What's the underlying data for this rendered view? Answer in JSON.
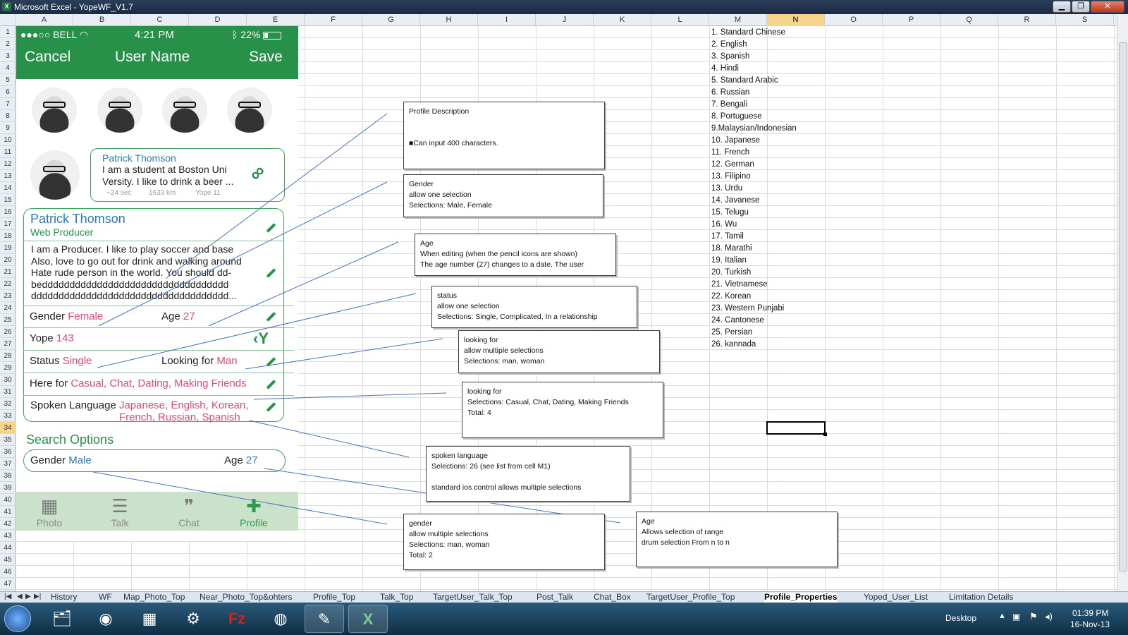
{
  "window": {
    "title": "Microsoft Excel - YopeWF_V1.7",
    "min": "▁",
    "max": "❐",
    "close": "✕"
  },
  "columns": [
    "A",
    "B",
    "C",
    "D",
    "E",
    "F",
    "G",
    "H",
    "I",
    "J",
    "K",
    "L",
    "M",
    "N",
    "O",
    "P",
    "Q",
    "R",
    "S"
  ],
  "rows": [
    "1",
    "2",
    "3",
    "4",
    "5",
    "6",
    "7",
    "8",
    "9",
    "10",
    "11",
    "12",
    "13",
    "14",
    "15",
    "16",
    "17",
    "18",
    "19",
    "20",
    "21",
    "22",
    "23",
    "24",
    "25",
    "26",
    "27",
    "28",
    "29",
    "30",
    "31",
    "32",
    "33",
    "34",
    "35",
    "36",
    "37",
    "38",
    "39",
    "40",
    "41",
    "42",
    "43",
    "44",
    "45",
    "46",
    "47"
  ],
  "phone": {
    "status_left": "●●●○○ BELL",
    "status_time": "4:21 PM",
    "status_battery": "22%",
    "nav_cancel": "Cancel",
    "nav_title": "User Name",
    "nav_save": "Save",
    "card_name": "Patrick Thomson",
    "card_text1": "I am a student at Boston Uni",
    "card_text2": "Versity. I like to drink a beer ...",
    "card_time": "~24 sec",
    "card_dist": "1633 km",
    "card_yope": "Yope 11",
    "profile_name": "Patrick Thomson",
    "profile_job": "Web Producer",
    "desc1": "I am a Producer. I like to play soccer and base",
    "desc2": "Also, love to go out for drink and walking around",
    "desc3": "Hate rude person in the world. You should dd-",
    "desc4": "bedddddddddddddddddddddddddddddddddd",
    "desc5": "dddddddddddddddddddddddddddddddddddd...",
    "gender_label": "Gender",
    "gender_value": "Female",
    "age_label": "Age",
    "age_value": "27",
    "yope_label": "Yope",
    "yope_value": "143",
    "status_label": "Status",
    "status_value": "Single",
    "looking_label": "Looking for",
    "looking_value": "Man",
    "herefor_label": "Here for",
    "herefor_value": "Casual, Chat, Dating, Making Friends",
    "spoken_label": "Spoken Language",
    "spoken_value1": "Japanese, English, Korean,",
    "spoken_value2": "French, Russian, Spanish",
    "search_title": "Search Options",
    "s_gender_label": "Gender",
    "s_gender_value": "Male",
    "s_age_label": "Age",
    "s_age_value": "27",
    "tabs": [
      "Photo",
      "Talk",
      "Chat",
      "Profile"
    ]
  },
  "languages": [
    "1. Standard Chinese",
    "2. English",
    "3. Spanish",
    "4. Hindi",
    "5. Standard Arabic",
    "6. Russian",
    "7. Bengali",
    "8. Portuguese",
    "9.Malaysian/Indonesian",
    "10. Japanese",
    "11. French",
    "12. German",
    "13. Filipino",
    "13. Urdu",
    "14. Javanese",
    "15. Telugu",
    "16. Wu",
    "17. Tamil",
    "18. Marathi",
    "19. Italian",
    "20. Turkish",
    "21. Vietnamese",
    "22. Korean",
    "23. Western Punjabi",
    "24. Cantonese",
    "25. Persian",
    "26. kannada"
  ],
  "notes": {
    "desc": {
      "l1": "Profile Description",
      "l2": "■Can input 400 characters."
    },
    "gender": {
      "l1": "Gender",
      "l2": "allow one selection",
      "l3": "Selections: Male, Female"
    },
    "age": {
      "l1": "Age",
      "l2": "When editing (when the pencil icons are shown)",
      "l3": "The age number (27) changes to a date.  The user"
    },
    "status": {
      "l1": "status",
      "l2": "allow one selection",
      "l3": "Selections: Single, Complicated,  In a relationship"
    },
    "looking": {
      "l1": "looking for",
      "l2": "allow multiple selections",
      "l3": "Selections: man, woman"
    },
    "herefor": {
      "l1": "looking for",
      "l2": "Selections: Casual, Chat, Dating, Making  Friends",
      "l3": "Total: 4"
    },
    "spoken": {
      "l1": "spoken language",
      "l2": "Selections: 26 (see list from cell M1)",
      "l3": "standard ios control  allows multiple selections"
    },
    "sgender": {
      "l1": "gender",
      "l2": "allow multiple selections",
      "l3": "Selections: man, woman",
      "l4": "Total: 2"
    },
    "sage": {
      "l1": "Age",
      "l2": "Allows selection of range",
      "l3": "drum selection  From  n to n"
    }
  },
  "sheet_tabs": [
    "History",
    "WF",
    "Map_Photo_Top",
    "Near_Photo_Top&ohters",
    "Profile_Top",
    "Talk_Top",
    "TargetUser_Talk_Top",
    "Post_Talk",
    "Chat_Box",
    "TargetUser_Profile_Top",
    "Profile_Properties",
    "Yoped_User_List",
    "Limitation Details"
  ],
  "active_sheet": "Profile_Properties",
  "taskbar": {
    "desktop": "Desktop",
    "time": "01:39 PM",
    "date": "16-Nov-13"
  }
}
